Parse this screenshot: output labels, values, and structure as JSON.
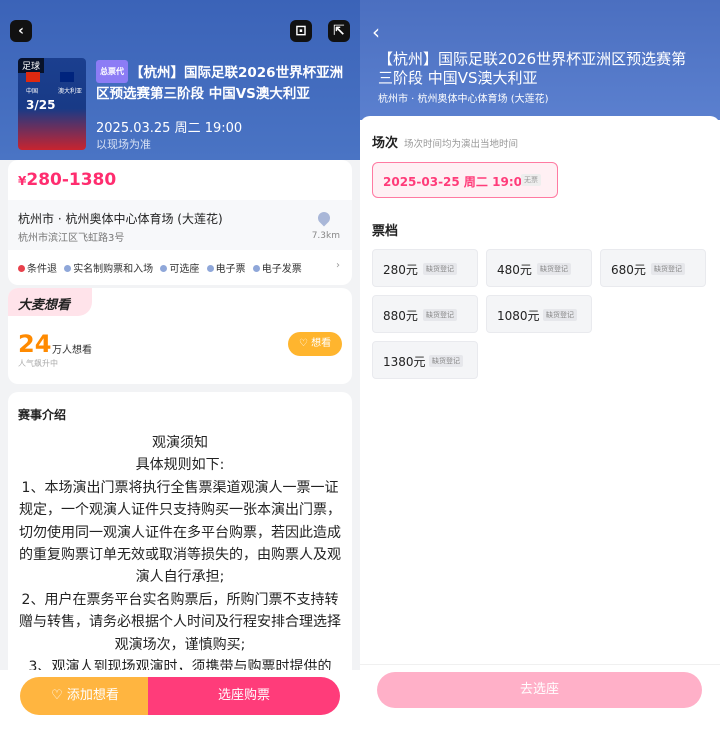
{
  "left": {
    "poster": {
      "tag": "足球",
      "date": "3/25",
      "team_a": "中国",
      "team_b": "澳大利亚"
    },
    "event": {
      "badge": "总票代",
      "title": "【杭州】国际足联2026世界杯亚洲区预选赛第三阶段 中国VS澳大利亚",
      "datetime": "2025.03.25 周二 19:00",
      "note": "以现场为准"
    },
    "price": {
      "symbol": "¥",
      "range": "280-1380"
    },
    "venue": {
      "name": "杭州市 · 杭州奥体中心体育场 (大莲花)",
      "address": "杭州市滨江区飞虹路3号",
      "distance": "7.3km"
    },
    "features": [
      "条件退",
      "实名制购票和入场",
      "可选座",
      "电子票",
      "电子发票"
    ],
    "want": {
      "header": "大麦想看",
      "count": "24",
      "unit": "万人想看",
      "sub": "人气飙升中",
      "button": "想看"
    },
    "intro": {
      "title": "赛事介绍",
      "lines": [
        "观演须知",
        "具体规则如下:",
        "1、本场演出门票将执行全售票渠道观演人一票一证规定，一个观演人证件只支持购买一张本演出门票，切勿使用同一观演人证件在多平台购票，若因此造成的重复购票订单无效或取消等损失的，由购票人及观演人自行承担;",
        "2、用户在票务平台实名购票后，所购门票不支持转赠与转售，请务必根据个人时间及行程安排合理选择观演场次，谨慎购买;",
        "3、观演人到现场观演时，须携带与购票时提供的"
      ]
    },
    "bottom": {
      "add": "添加想看",
      "buy": "选座购票"
    }
  },
  "right": {
    "title": "【杭州】国际足联2026世界杯亚洲区预选赛第三阶段 中国VS澳大利亚",
    "subtitle": "杭州市 · 杭州奥体中心体育场 (大莲花)",
    "session_label": "场次",
    "session_hint": "场次时间均为演出当地时间",
    "session": {
      "text": "2025-03-25 周二 19:00",
      "tag": "无票"
    },
    "tier_label": "票档",
    "tiers": [
      {
        "price": "280元",
        "tag": "缺货登记"
      },
      {
        "price": "480元",
        "tag": "缺货登记"
      },
      {
        "price": "680元",
        "tag": "缺货登记"
      },
      {
        "price": "880元",
        "tag": "缺货登记"
      },
      {
        "price": "1080元",
        "tag": "缺货登记"
      },
      {
        "price": "1380元",
        "tag": "缺货登记"
      }
    ],
    "go_button": "去选座"
  },
  "colors": {
    "accent": "#ff3c7a",
    "orange": "#ffb540",
    "header_blue": "#3b63b8"
  }
}
